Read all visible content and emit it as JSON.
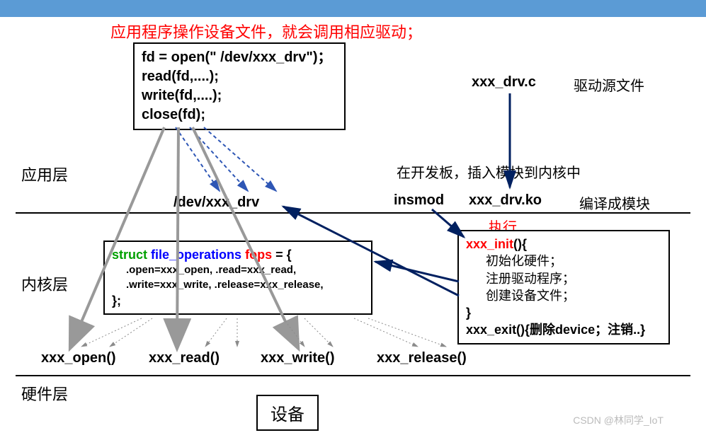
{
  "title": "应用程序操作设备文件，就会调用相应驱动；",
  "app_code": {
    "line1": "fd = open(\" /dev/xxx_drv\")；",
    "line2": "read(fd,....);",
    "line3": "write(fd,....);",
    "line4": "close(fd);"
  },
  "labels": {
    "app_layer": "应用层",
    "kernel_layer": "内核层",
    "hw_layer": "硬件层",
    "drv_src_file": "xxx_drv.c",
    "drv_src_desc": "驱动源文件",
    "insmod_desc": "在开发板，插入模块到内核中",
    "insmod": "insmod",
    "drv_ko": "xxx_drv.ko",
    "compile_mod": "编译成模块",
    "dev_node": "/dev/xxx_drv",
    "execute": "执行",
    "device": "设备",
    "xxx_open": "xxx_open()",
    "xxx_read": "xxx_read()",
    "xxx_write": "xxx_write()",
    "xxx_release": "xxx_release()"
  },
  "fops_code": {
    "decl_struct": "struct",
    "decl_type": "file_operations",
    "decl_var": "fops",
    "decl_tail": " = {",
    "body1": ".open=xxx_open, .read=xxx_read,",
    "body2": ".write=xxx_write, .release=xxx_release,",
    "close": "};"
  },
  "init_code": {
    "head": "xxx_init",
    "head_tail": "(){",
    "b1": "初始化硬件；",
    "b2": "注册驱动程序；",
    "b3": "创建设备文件；",
    "close": "}",
    "exit": "xxx_exit(){删除device；注销..}"
  },
  "watermark": "CSDN @林同学_IoT"
}
